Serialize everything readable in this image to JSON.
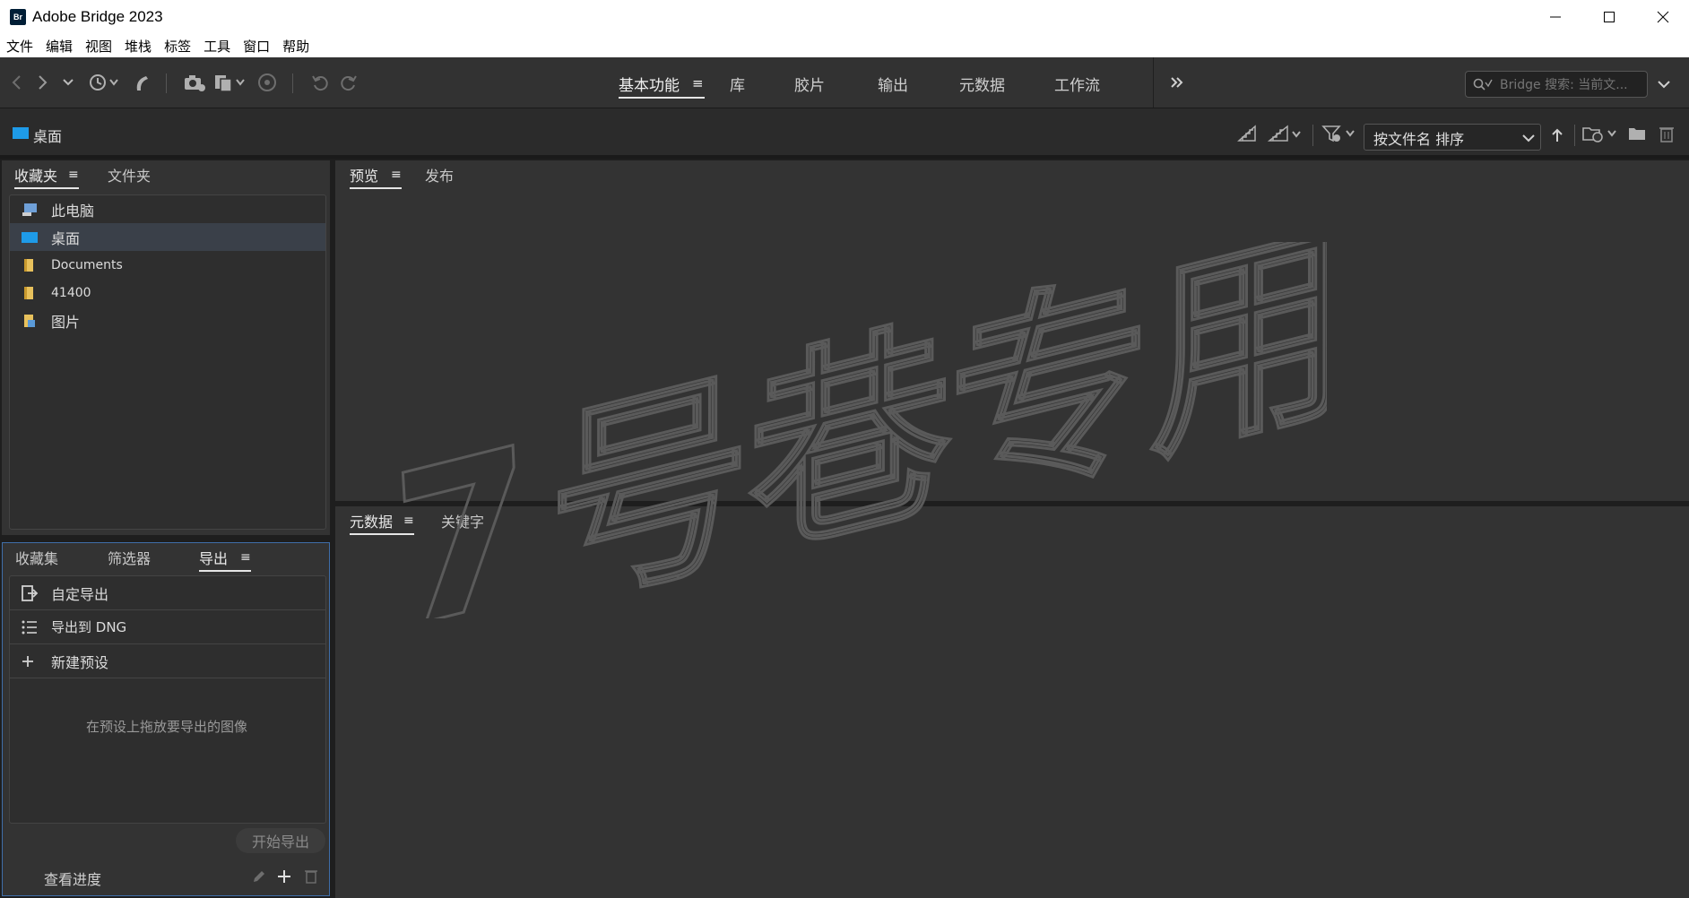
{
  "window": {
    "title": "Adobe Bridge 2023",
    "logo_text": "Br"
  },
  "menu": [
    "文件",
    "编辑",
    "视图",
    "堆栈",
    "标签",
    "工具",
    "窗口",
    "帮助"
  ],
  "workspaces": {
    "tabs": [
      "基本功能",
      "库",
      "胶片",
      "输出",
      "元数据",
      "工作流"
    ],
    "active": "基本功能"
  },
  "search": {
    "placeholder": "Bridge 搜索: 当前文..."
  },
  "path": {
    "current": "桌面"
  },
  "sort": {
    "label": "按文件名 排序"
  },
  "top_left_panel": {
    "tabs": [
      "收藏夹",
      "文件夹"
    ],
    "active": "收藏夹",
    "items": [
      {
        "label": "此电脑",
        "icon": "computer-icon"
      },
      {
        "label": "桌面",
        "icon": "desktop-icon",
        "selected": true
      },
      {
        "label": "Documents",
        "icon": "folder-icon"
      },
      {
        "label": "41400",
        "icon": "folder-icon"
      },
      {
        "label": "图片",
        "icon": "pictures-folder-icon"
      }
    ]
  },
  "bottom_left_panel": {
    "tabs": [
      "收藏集",
      "筛选器",
      "导出"
    ],
    "active": "导出",
    "items": [
      {
        "label": "自定导出",
        "icon": "export-icon"
      },
      {
        "label": "导出到 DNG",
        "icon": "list-icon"
      },
      {
        "label": "新建预设",
        "icon": "plus-icon"
      }
    ],
    "drop_hint": "在预设上拖放要导出的图像",
    "start_button": "开始导出",
    "view_progress": "查看进度"
  },
  "preview_panel": {
    "tabs": [
      "预览",
      "发布"
    ],
    "active": "预览"
  },
  "metadata_panel": {
    "tabs": [
      "元数据",
      "关键字"
    ],
    "active": "元数据"
  },
  "watermark": {
    "text": "7号巷专用"
  },
  "colors": {
    "panel_bg": "#333333",
    "selected_bg": "#3a4049",
    "desktop_blue": "#1e9be8",
    "folder_yellow": "#e8c15c",
    "export_panel_border": "#3f6ea8"
  }
}
